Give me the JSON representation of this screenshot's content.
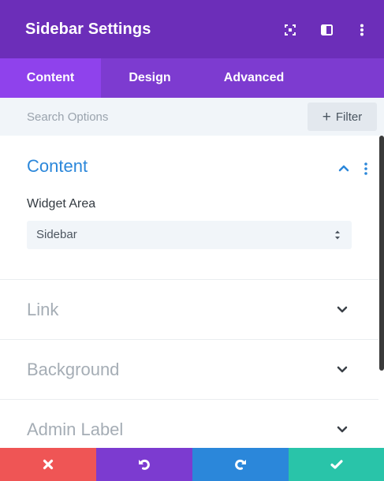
{
  "colors": {
    "header_bg": "#6c2eb9",
    "tabs_bg": "#7d3bd0",
    "active_tab_bg": "#8f42ec",
    "accent_blue": "#2b87da",
    "discard": "#ef5555",
    "undo": "#7c3bd0",
    "redo": "#2b87da",
    "save": "#29c4a9"
  },
  "header": {
    "title": "Sidebar Settings",
    "icons": [
      "fullscreen-icon",
      "split-view-icon",
      "more-options-icon"
    ]
  },
  "tabs": [
    {
      "label": "Content",
      "active": true
    },
    {
      "label": "Design",
      "active": false
    },
    {
      "label": "Advanced",
      "active": false
    }
  ],
  "search": {
    "placeholder": "Search Options",
    "filter_label": "Filter"
  },
  "sections": {
    "content": {
      "title": "Content",
      "expanded": true,
      "field_label": "Widget Area",
      "select_value": "Sidebar"
    },
    "link": {
      "title": "Link",
      "expanded": false
    },
    "background": {
      "title": "Background",
      "expanded": false
    },
    "admin_label": {
      "title": "Admin Label",
      "expanded": false
    }
  },
  "footer": {
    "buttons": [
      "discard-icon",
      "undo-icon",
      "redo-icon",
      "save-icon"
    ]
  }
}
